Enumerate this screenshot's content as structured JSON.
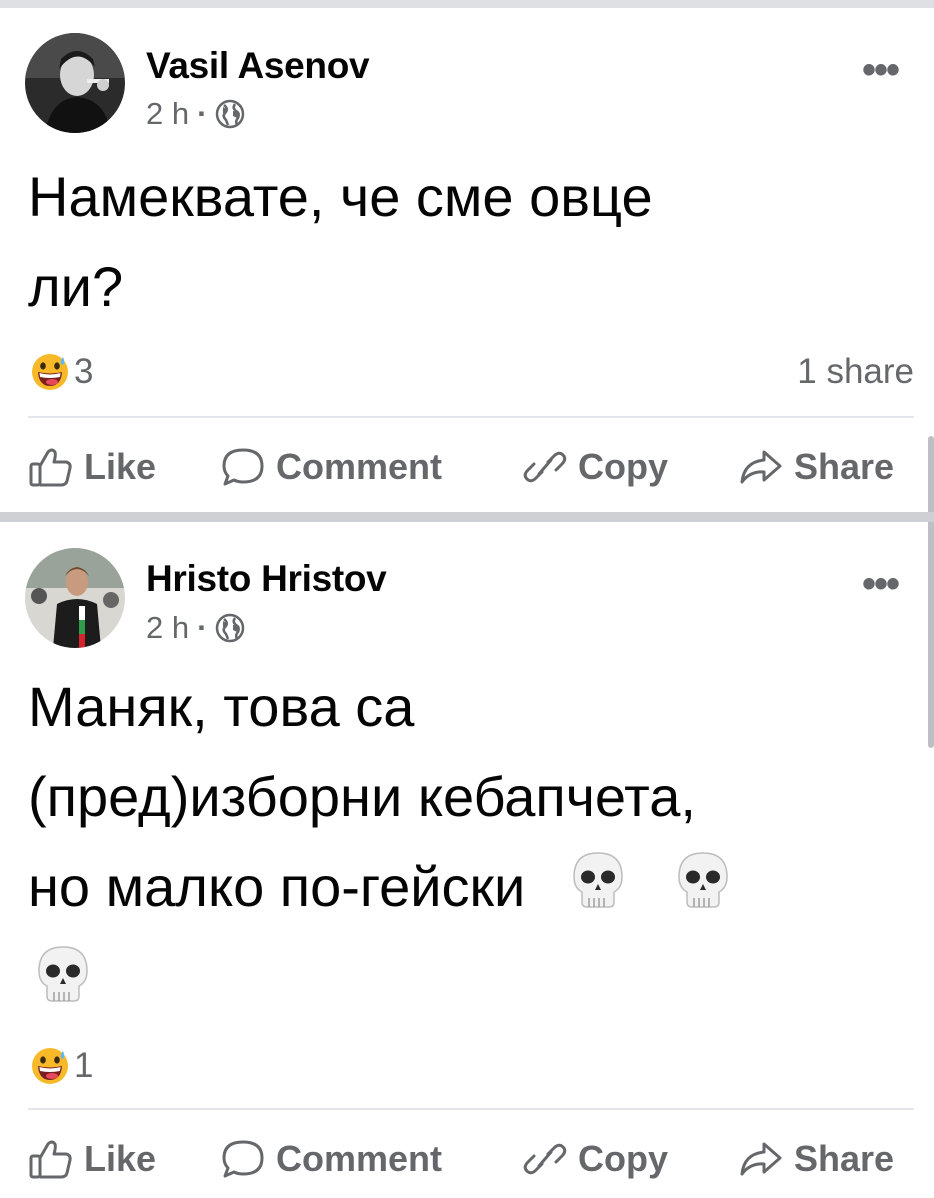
{
  "posts": [
    {
      "author": "Vasil Asenov",
      "time": "2 h",
      "separator": "·",
      "text_lines": [
        "Намеквате, че сме овце",
        "ли?"
      ],
      "reaction_count": "3",
      "share_count": "1 share",
      "more": "•••",
      "actions": {
        "like": "Like",
        "comment": "Comment",
        "copy": "Copy",
        "share": "Share"
      }
    },
    {
      "author": "Hristo Hristov",
      "time": "2 h",
      "separator": "·",
      "text_lines": [
        "Маняк, това са",
        "(пред)изборни кебапчета,",
        "но малко по-гейски"
      ],
      "reaction_count": "1",
      "more": "•••",
      "actions": {
        "like": "Like",
        "comment": "Comment",
        "copy": "Copy",
        "share": "Share"
      }
    }
  ],
  "icons": {
    "avatar": "avatar-photo",
    "privacy": "globe-icon",
    "reaction": "grinning-sweat-emoji",
    "emoji": "skull-emoji",
    "like": "thumbs-up-icon",
    "comment": "comment-bubble-icon",
    "copy": "link-icon",
    "share": "share-arrow-icon"
  },
  "colors": {
    "text": "#050505",
    "secondary": "#65676b",
    "divider": "#ced0d4"
  }
}
